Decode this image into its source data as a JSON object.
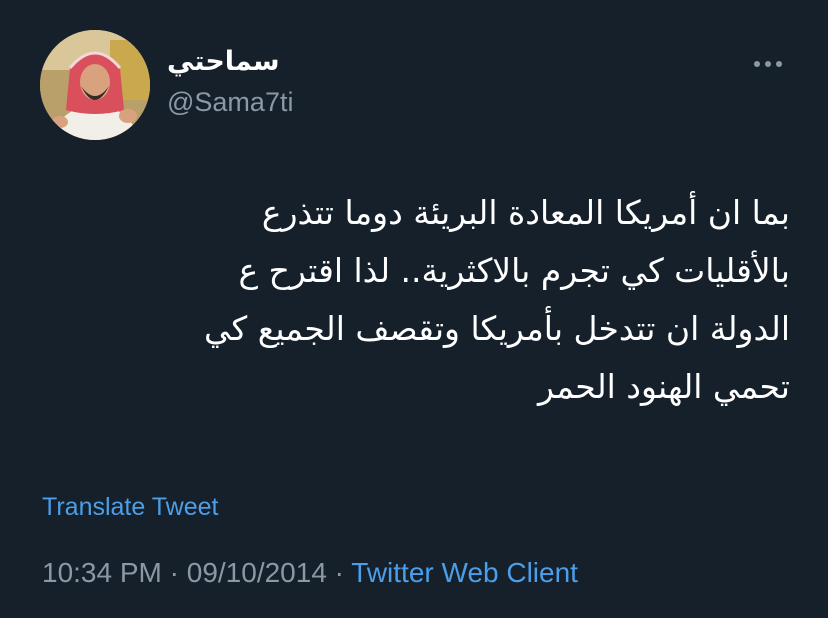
{
  "user": {
    "display_name": "سماحتي",
    "handle": "@Sama7ti",
    "avatar_icon": "profile-photo"
  },
  "more_icon": "more-horizontal-icon",
  "tweet": {
    "lines": [
      "بما ان أمريكا المعادة البريئة دوما تتذرع",
      "بالأقليات كي تجرم بالاكثرية.. لذا اقترح ع",
      "الدولة ان تتدخل بأمريكا وتقصف الجميع كي",
      "تحمي الهنود الحمر"
    ]
  },
  "translate_label": "Translate Tweet",
  "meta": {
    "time": "10:34 PM",
    "separator": "·",
    "date": "09/10/2014",
    "source": "Twitter Web Client"
  },
  "colors": {
    "background": "#15202b",
    "text": "#ffffff",
    "secondary": "#8b98a5",
    "link": "#4c9ee8"
  }
}
